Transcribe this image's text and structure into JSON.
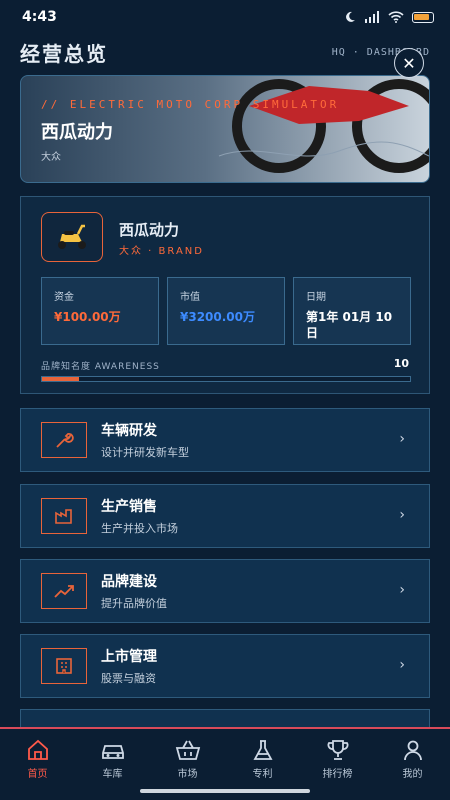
{
  "status_bar": {
    "time": "4:43"
  },
  "header": {
    "title": "经营总览",
    "breadcrumb": "HQ · DASHBOARD"
  },
  "banner": {
    "tag": "// ELECTRIC MOTO CORP SIMULATOR",
    "title": "西瓜动力",
    "subtitle": "大众"
  },
  "brand": {
    "name": "西瓜动力",
    "tag": "大众 · BRAND",
    "stats": [
      {
        "label": "资金",
        "value": "¥100.00万",
        "color": "#ff6a3a"
      },
      {
        "label": "市值",
        "value": "¥3200.00万",
        "color": "#3d8bff"
      },
      {
        "label": "日期",
        "value": "第1年 01月 10日",
        "color": "#ffffff"
      }
    ],
    "awareness": {
      "label": "品牌知名度 AWARENESS",
      "value": "10",
      "fraction": 0.1
    }
  },
  "menu": [
    {
      "title": "车辆研发",
      "desc": "设计并研发新车型",
      "icon": "wrench-icon"
    },
    {
      "title": "生产销售",
      "desc": "生产并投入市场",
      "icon": "factory-icon"
    },
    {
      "title": "品牌建设",
      "desc": "提升品牌价值",
      "icon": "trend-up-icon"
    },
    {
      "title": "上市管理",
      "desc": "股票与融资",
      "icon": "building-icon"
    }
  ],
  "tabs": [
    {
      "label": "首页",
      "icon": "home-icon"
    },
    {
      "label": "车库",
      "icon": "car-icon"
    },
    {
      "label": "市场",
      "icon": "basket-icon"
    },
    {
      "label": "专利",
      "icon": "flask-icon"
    },
    {
      "label": "排行榜",
      "icon": "trophy-icon"
    },
    {
      "label": "我的",
      "icon": "user-icon"
    }
  ],
  "colors": {
    "accent": "#e8643a",
    "background": "#0b1e33",
    "tab_active": "#ff5a4a"
  }
}
